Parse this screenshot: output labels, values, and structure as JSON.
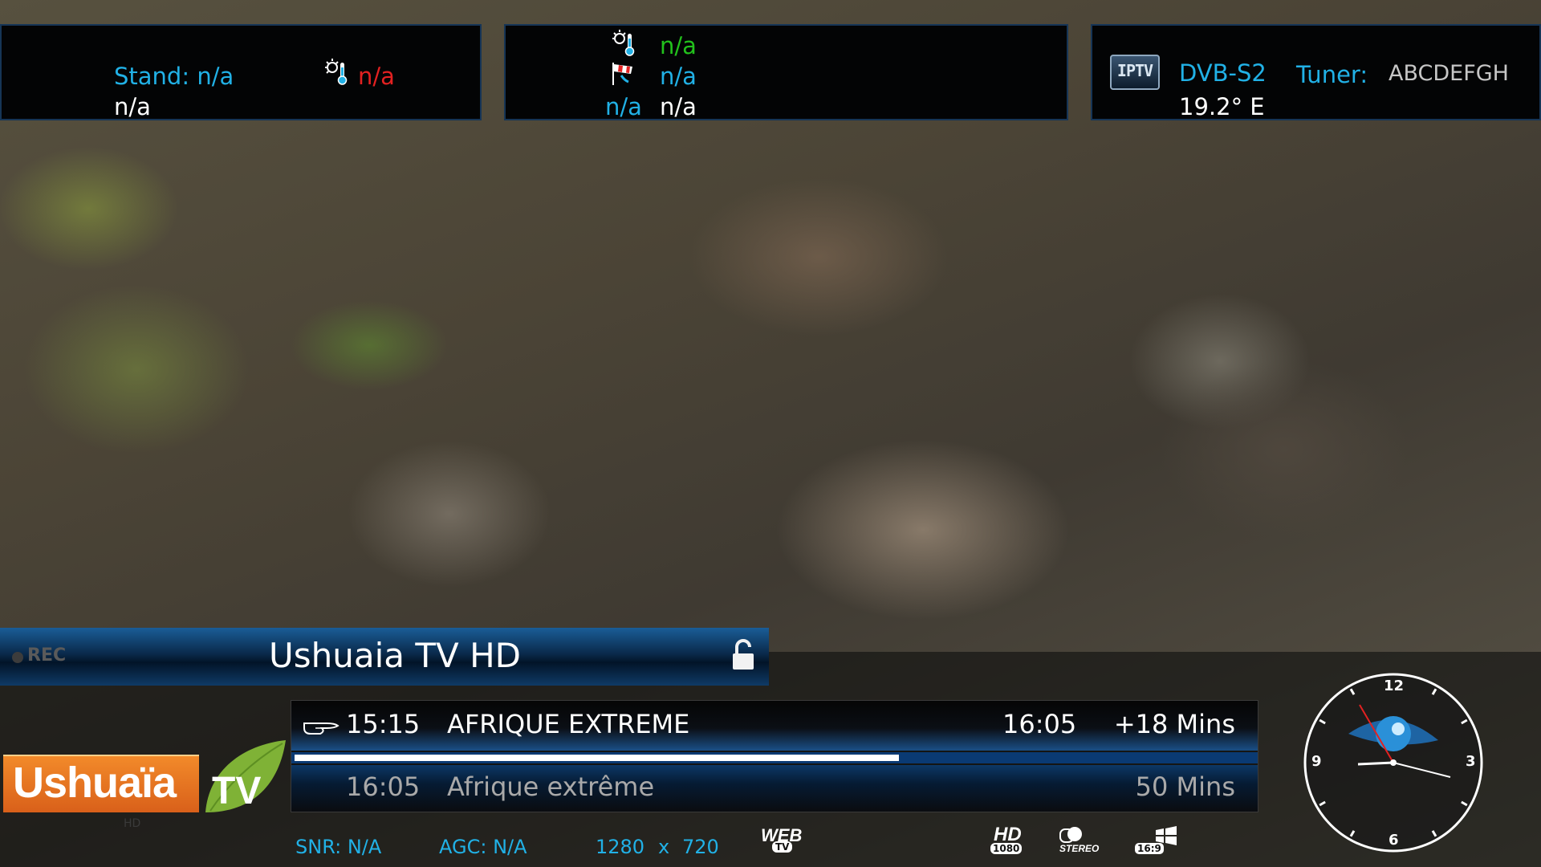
{
  "top_panels": {
    "left": {
      "stand_label": "Stand: n/a",
      "stand_value": "n/a",
      "temp_value": "n/a"
    },
    "middle": {
      "row1": "n/a",
      "row2": "n/a",
      "row3_a": "n/a",
      "row3_b": "n/a"
    },
    "right": {
      "iptv_icon": "IPTV",
      "system": "DVB-S2",
      "tuner_label": "Tuner:",
      "tuner_name": "ABCDEFGH",
      "position": "19.2° E"
    }
  },
  "channel_bar": {
    "rec_label": "REC",
    "channel_name": "Ushuaia TV HD",
    "lock_icon": "unlock-icon"
  },
  "epg": {
    "now": {
      "start": "15:15",
      "title": "AFRIQUE EXTREME",
      "end": "16:05",
      "remaining": "+18 Mins"
    },
    "progress": 0.63,
    "next": {
      "start": "16:05",
      "title": "Afrique extrême",
      "duration": "50 Mins"
    }
  },
  "logo": {
    "name": "Ushuaïa",
    "tv": "TV",
    "sub": "HD"
  },
  "status": {
    "snr": "SNR: N/A",
    "agc": "AGC: N/A",
    "res_w": "1280",
    "res_x": "x",
    "res_h": "720"
  },
  "badges": {
    "web": "WEB",
    "web_sub": "TV",
    "hd": "HD",
    "hd_sub": "1080",
    "stereo": "STEREO",
    "aspect": "16:9"
  },
  "clock": {
    "n12": "12",
    "n3": "3",
    "n6": "6",
    "n9": "9"
  },
  "colors": {
    "accent": "#21b1e6",
    "alert": "#e32121",
    "ok": "#22c11c",
    "logo_orange": "#e8701f",
    "logo_green": "#7fb236"
  }
}
